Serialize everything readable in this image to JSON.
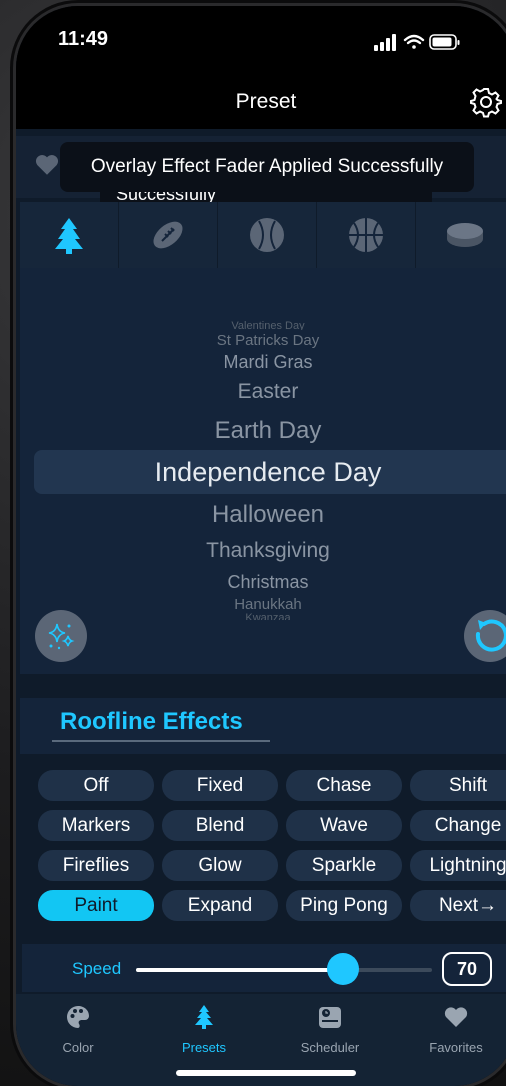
{
  "status": {
    "time": "11:49"
  },
  "header": {
    "title": "Preset"
  },
  "toasts": {
    "primary": "Overlay Effect Fader Applied Successfully",
    "secondary": "Successfully"
  },
  "sports": [
    "tree",
    "football",
    "baseball",
    "basketball",
    "hockey-puck"
  ],
  "holidays": {
    "items": [
      "Valentines Day",
      "St Patricks Day",
      "Mardi Gras",
      "Easter",
      "Earth Day",
      "Independence Day",
      "Halloween",
      "Thanksgiving",
      "Christmas",
      "Hanukkah",
      "Kwanzaa"
    ],
    "selected": "Independence Day"
  },
  "roofline": {
    "title": "Roofline Effects",
    "effects": [
      [
        "Off",
        "Fixed",
        "Chase",
        "Shift"
      ],
      [
        "Markers",
        "Blend",
        "Wave",
        "Change"
      ],
      [
        "Fireflies",
        "Glow",
        "Sparkle",
        "Lightning"
      ],
      [
        "Paint",
        "Expand",
        "Ping Pong",
        "Next→"
      ]
    ],
    "active": "Paint"
  },
  "speed": {
    "label": "Speed",
    "value": "70",
    "level": 0.7
  },
  "tabs": [
    {
      "label": "Color",
      "icon": "palette-icon"
    },
    {
      "label": "Presets",
      "icon": "tree-icon"
    },
    {
      "label": "Scheduler",
      "icon": "scheduler-icon"
    },
    {
      "label": "Favorites",
      "icon": "heart-icon"
    }
  ],
  "colors": {
    "accent": "#1fc7ff",
    "panel": "#14243a",
    "background": "#0f1b2a"
  }
}
